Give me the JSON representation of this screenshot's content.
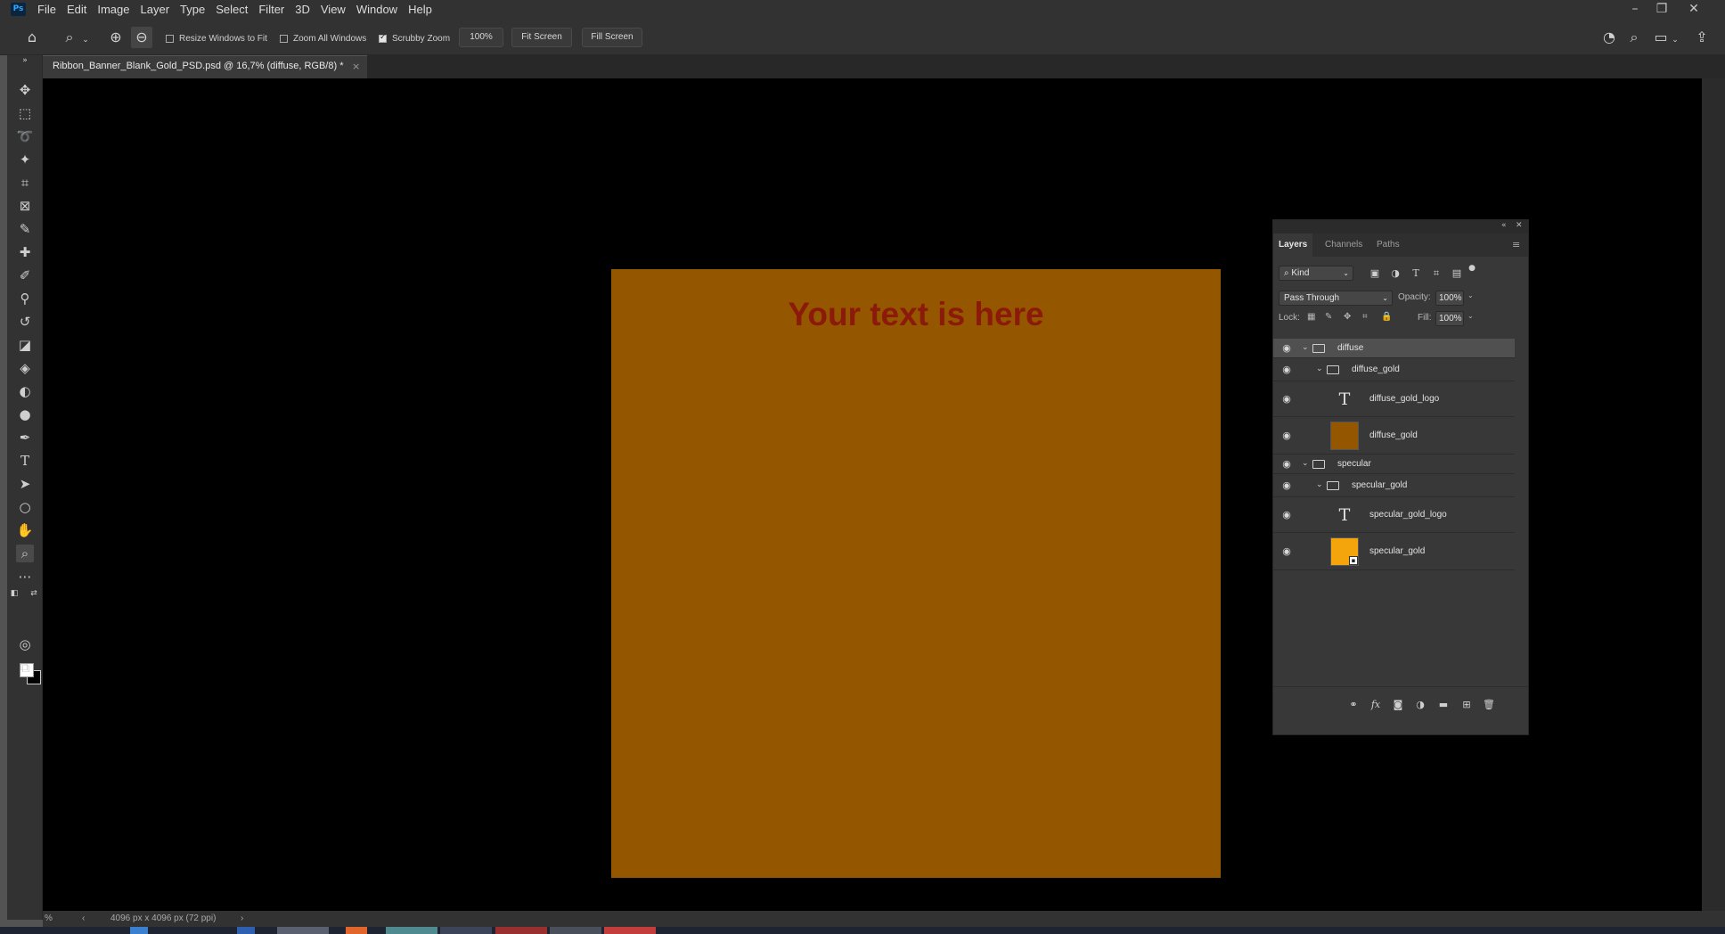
{
  "app": {
    "logo": "Ps"
  },
  "menubar": {
    "items": [
      "File",
      "Edit",
      "Image",
      "Layer",
      "Type",
      "Select",
      "Filter",
      "3D",
      "View",
      "Window",
      "Help"
    ]
  },
  "window_controls": {
    "minimize": "–",
    "restore": "❐",
    "close": "✕"
  },
  "options": {
    "resize_windows": "Resize Windows to Fit",
    "zoom_all": "Zoom All Windows",
    "scrubby_zoom": "Scrubby Zoom",
    "zoom_value": "100%",
    "fit_screen": "Fit Screen",
    "fill_screen": "Fill Screen",
    "checkbox_states": {
      "resize_windows": false,
      "zoom_all": false,
      "scrubby_zoom": true
    }
  },
  "document": {
    "tab_title": "Ribbon_Banner_Blank_Gold_PSD.psd @ 16,7% (diffuse, RGB/8) *",
    "tab_close": "×",
    "canvas_text": "Your text is here",
    "canvas_color": "#955600",
    "text_color": "#8b1a0b"
  },
  "status": {
    "zoom": "%",
    "doc_size": "4096 px x 4096 px (72 ppi)"
  },
  "layers_panel": {
    "tabs": [
      "Layers",
      "Channels",
      "Paths"
    ],
    "filter_kind": "Kind",
    "blend_mode": "Pass Through",
    "opacity_label": "Opacity:",
    "opacity_value": "100%",
    "lock_label": "Lock:",
    "fill_label": "Fill:",
    "fill_value": "100%",
    "layers": [
      {
        "name": "diffuse",
        "type": "group"
      },
      {
        "name": "diffuse_gold",
        "type": "group"
      },
      {
        "name": "diffuse_gold_logo",
        "type": "text"
      },
      {
        "name": "diffuse_gold",
        "type": "fill",
        "color": "#955600"
      },
      {
        "name": "specular",
        "type": "group"
      },
      {
        "name": "specular_gold",
        "type": "group"
      },
      {
        "name": "specular_gold_logo",
        "type": "text"
      },
      {
        "name": "specular_gold",
        "type": "smart",
        "color": "#f4a50b"
      }
    ]
  }
}
